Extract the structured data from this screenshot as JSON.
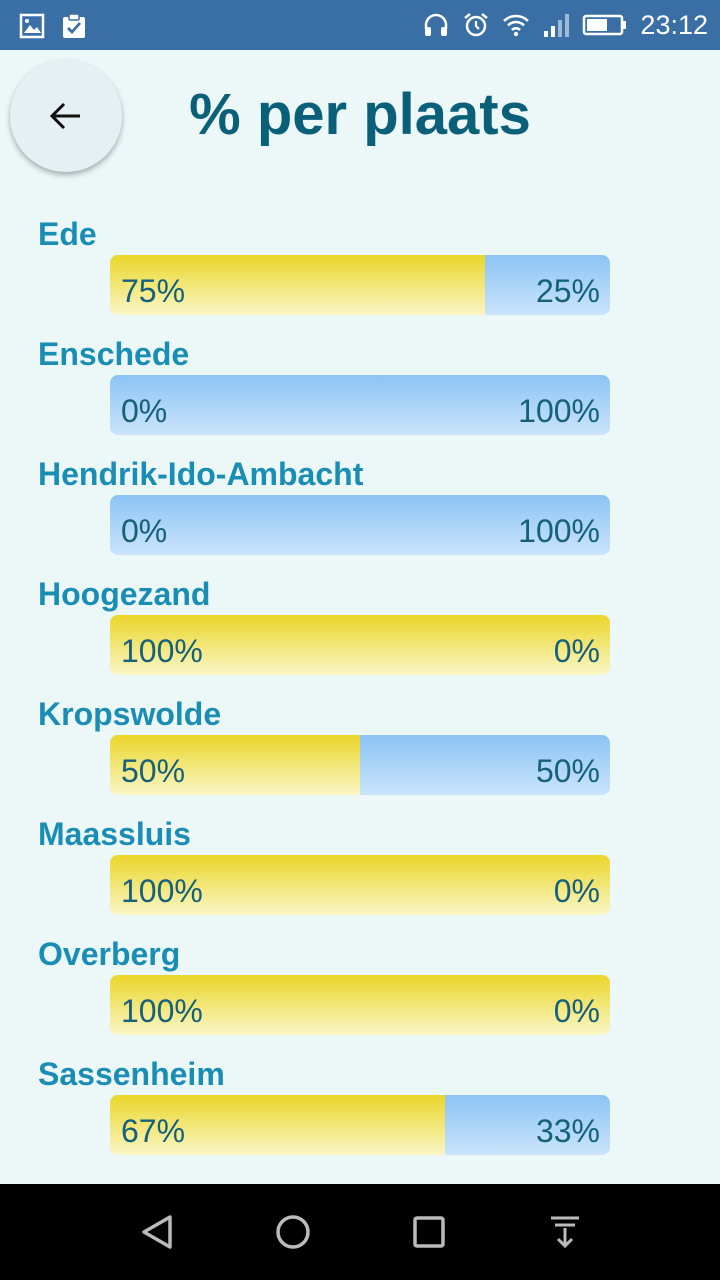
{
  "status_bar": {
    "time": "23:12",
    "left_icons": [
      "image-icon",
      "clipboard-check-icon"
    ],
    "right_icons": [
      "headphones-icon",
      "alarm-icon",
      "wifi-icon",
      "signal-icon",
      "battery-icon"
    ]
  },
  "header": {
    "title": "% per plaats",
    "back_icon": "arrow-left-icon"
  },
  "colors": {
    "yes": "#ead62a",
    "no": "#8cc4f5",
    "title": "#0a5f79",
    "city": "#1a8db5",
    "status_bar": "#3a6fa6"
  },
  "places": [
    {
      "city": "Ede",
      "yes": 75,
      "no": 25,
      "yes_label": "75%",
      "no_label": "25%"
    },
    {
      "city": "Enschede",
      "yes": 0,
      "no": 100,
      "yes_label": "0%",
      "no_label": "100%"
    },
    {
      "city": "Hendrik-Ido-Ambacht",
      "yes": 0,
      "no": 100,
      "yes_label": "0%",
      "no_label": "100%"
    },
    {
      "city": "Hoogezand",
      "yes": 100,
      "no": 0,
      "yes_label": "100%",
      "no_label": "0%"
    },
    {
      "city": "Kropswolde",
      "yes": 50,
      "no": 50,
      "yes_label": "50%",
      "no_label": "50%"
    },
    {
      "city": "Maassluis",
      "yes": 100,
      "no": 0,
      "yes_label": "100%",
      "no_label": "0%"
    },
    {
      "city": "Overberg",
      "yes": 100,
      "no": 0,
      "yes_label": "100%",
      "no_label": "0%"
    },
    {
      "city": "Sassenheim",
      "yes": 67,
      "no": 33,
      "yes_label": "67%",
      "no_label": "33%"
    }
  ],
  "nav_bar": {
    "buttons": [
      "back-triangle-icon",
      "home-circle-icon",
      "recents-square-icon",
      "notifications-down-icon"
    ]
  }
}
